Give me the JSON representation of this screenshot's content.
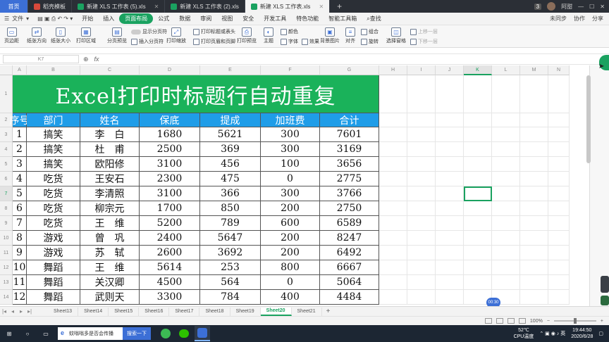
{
  "tabs": [
    {
      "label": "首页",
      "kind": "home"
    },
    {
      "label": "稻壳模板",
      "kind": "docer",
      "color": "#d9493b"
    },
    {
      "label": "新建 XLS 工作表 (5).xls",
      "kind": "sheet",
      "color": "#1aa260"
    },
    {
      "label": "新建 XLS 工作表 (2).xls",
      "kind": "sheet",
      "color": "#1aa260"
    },
    {
      "label": "新建 XLS 工作表.xls",
      "kind": "sheet",
      "active": true,
      "color": "#1aa260"
    }
  ],
  "tab_add": "+",
  "tab_right": {
    "badge": "3",
    "user": "阿甜"
  },
  "menu": {
    "file": "文件",
    "items": [
      "开始",
      "插入",
      "页面布局",
      "公式",
      "数据",
      "审阅",
      "视图",
      "安全",
      "开发工具",
      "特色功能",
      "智能工具箱"
    ],
    "active": "页面布局",
    "search": "查找",
    "right": [
      "未同步",
      "协作",
      "分享"
    ]
  },
  "ribbon": {
    "big": [
      "页边距",
      "纸张方向",
      "纸张大小",
      "打印区域",
      "分页预览",
      "打印缩放",
      "打印预览",
      "主题",
      "对齐",
      "选择窗格"
    ],
    "small": {
      "show_pagebreak": "显示分页符",
      "insert_pagebreak": "插入分页符",
      "print_titles": "打印标题或表头",
      "header_footer": "打印页眉和页脚",
      "colors": "颜色",
      "fonts": "字体",
      "effects": "效果",
      "background": "背景图片",
      "group": "组合",
      "rotate": "旋转",
      "up_layer": "上移一层",
      "down_layer": "下移一层"
    }
  },
  "formula_bar": {
    "namebox": "K7",
    "fx": "fx"
  },
  "columns": [
    "A",
    "B",
    "C",
    "D",
    "E",
    "F",
    "G",
    "H",
    "I",
    "J",
    "K",
    "L",
    "M",
    "N"
  ],
  "selected_column": "K",
  "selected_row": "7",
  "row_numbers": [
    "1",
    "2",
    "3",
    "4",
    "5",
    "6",
    "7",
    "8",
    "9",
    "10",
    "11",
    "12",
    "13",
    "14"
  ],
  "sheet": {
    "title": "Excel打印时标题行自动重复",
    "headers": [
      "序号",
      "部门",
      "姓名",
      "保底",
      "提成",
      "加班费",
      "合计"
    ],
    "rows": [
      [
        "1",
        "搞笑",
        "李　白",
        "1680",
        "5621",
        "300",
        "7601"
      ],
      [
        "2",
        "搞笑",
        "杜　甫",
        "2500",
        "369",
        "300",
        "3169"
      ],
      [
        "3",
        "搞笑",
        "欧阳修",
        "3100",
        "456",
        "100",
        "3656"
      ],
      [
        "4",
        "吃货",
        "王安石",
        "2300",
        "475",
        "0",
        "2775"
      ],
      [
        "5",
        "吃货",
        "李清照",
        "3100",
        "366",
        "300",
        "3766"
      ],
      [
        "6",
        "吃货",
        "柳宗元",
        "1700",
        "850",
        "200",
        "2750"
      ],
      [
        "7",
        "吃货",
        "王　维",
        "5200",
        "789",
        "600",
        "6589"
      ],
      [
        "8",
        "游戏",
        "曾　巩",
        "2400",
        "5647",
        "200",
        "8247"
      ],
      [
        "9",
        "游戏",
        "苏　轼",
        "2600",
        "3692",
        "200",
        "6492"
      ],
      [
        "10",
        "舞蹈",
        "王　维",
        "5614",
        "253",
        "800",
        "6667"
      ],
      [
        "11",
        "舞蹈",
        "关汉卿",
        "4500",
        "564",
        "0",
        "5064"
      ],
      [
        "12",
        "舞蹈",
        "武则天",
        "3300",
        "784",
        "400",
        "4484"
      ]
    ]
  },
  "sheet_tabs": [
    "Sheet13",
    "Sheet14",
    "Sheet15",
    "Sheet16",
    "Sheet17",
    "Sheet18",
    "Sheet19",
    "Sheet20",
    "Sheet21"
  ],
  "active_sheet": "Sheet20",
  "sheet_add": "+",
  "status": {
    "zoom": "100%",
    "overlay_timer": "00:30"
  },
  "taskbar": {
    "search_text": "蚊嗡嗡多是否会传播",
    "search_button": "搜索一下",
    "weather_temp": "52℃",
    "weather_label": "CPU温度",
    "time": "19:44:50",
    "date": "2020/6/28"
  }
}
